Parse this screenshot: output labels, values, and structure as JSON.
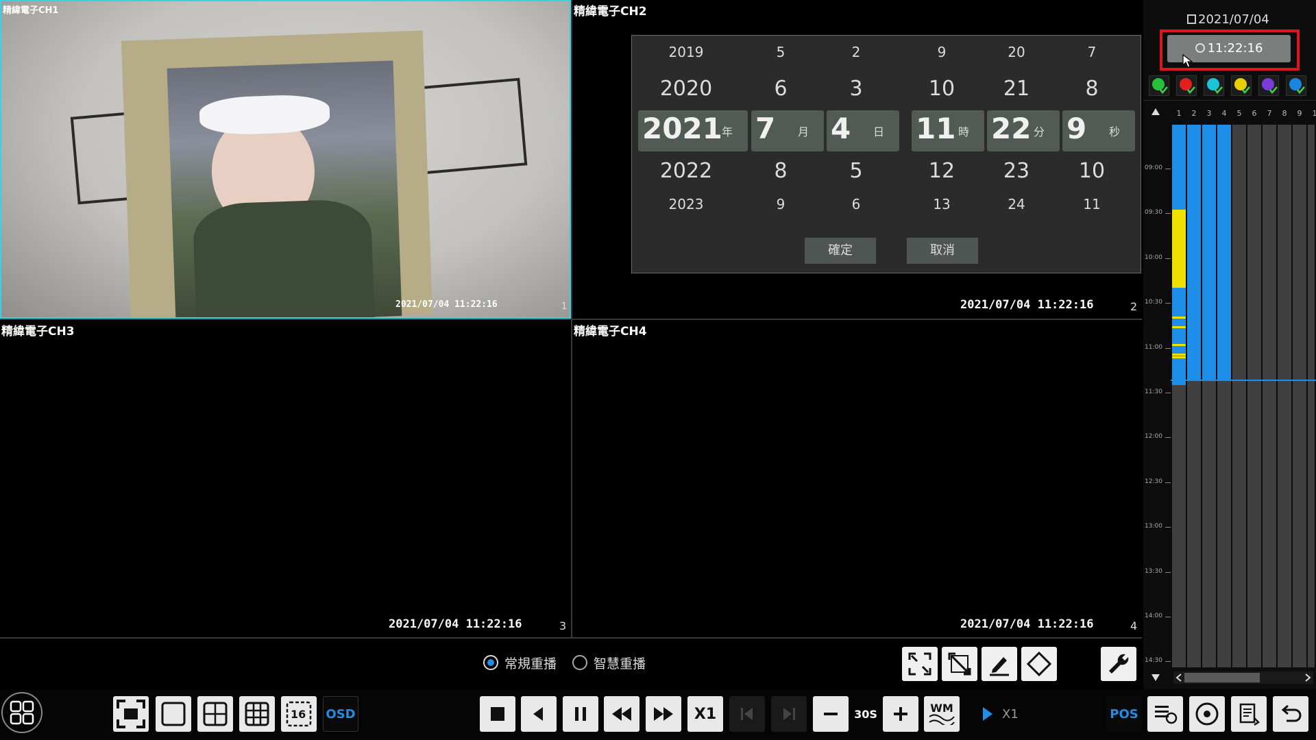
{
  "channels": [
    {
      "title": "精緯電子CH1",
      "timestamp": "2021/07/04 11:22:16",
      "number": "1"
    },
    {
      "title": "精緯電子CH2",
      "timestamp": "2021/07/04 11:22:16",
      "number": "2"
    },
    {
      "title": "精緯電子CH3",
      "timestamp": "2021/07/04 11:22:16",
      "number": "3"
    },
    {
      "title": "精緯電子CH4",
      "timestamp": "2021/07/04 11:22:16",
      "number": "4"
    }
  ],
  "picker": {
    "columns": [
      {
        "above2": "2019",
        "above1": "2020",
        "value": "2021",
        "unit": "年",
        "below1": "2022",
        "below2": "2023"
      },
      {
        "above2": "5",
        "above1": "6",
        "value": "7",
        "unit": "月",
        "below1": "8",
        "below2": "9"
      },
      {
        "above2": "2",
        "above1": "3",
        "value": "4",
        "unit": "日",
        "below1": "5",
        "below2": "6"
      },
      {
        "above2": "9",
        "above1": "10",
        "value": "11",
        "unit": "時",
        "below1": "12",
        "below2": "13"
      },
      {
        "above2": "20",
        "above1": "21",
        "value": "22",
        "unit": "分",
        "below1": "23",
        "below2": "24"
      },
      {
        "above2": "7",
        "above1": "8",
        "value": "9",
        "unit": "秒",
        "below1": "10",
        "below2": "11"
      }
    ],
    "confirm_label": "確定",
    "cancel_label": "取消"
  },
  "side_panel": {
    "date": "2021/07/04",
    "time": "11:22:16",
    "channel_headers": [
      "1",
      "2",
      "3",
      "4",
      "5",
      "6",
      "7",
      "8",
      "9",
      "1"
    ],
    "time_ticks": [
      "09:00",
      "09:30",
      "10:00",
      "10:30",
      "11:00",
      "11:30",
      "12:00",
      "12:30",
      "13:00",
      "13:30",
      "14:00",
      "14:30"
    ],
    "event_icon_colors": [
      "#27c23a",
      "#e32020",
      "#19c6d8",
      "#e8d000",
      "#7a3cd8",
      "#1a86e0"
    ]
  },
  "playback_mode": {
    "normal_label": "常規重播",
    "smart_label": "智慧重播",
    "selected": "normal"
  },
  "toolbar": {
    "osd_label": "OSD",
    "speed_label": "X1",
    "skip_label": "30S",
    "wm_label": "WM",
    "play_speed_label": "X1",
    "pos_label": "POS",
    "layout_16_label": "16"
  },
  "colors": {
    "recording_blue": "#1e8ee8",
    "event_yellow": "#f2e000",
    "selection_border": "#39d1e6",
    "highlight_red": "#e0141e"
  }
}
